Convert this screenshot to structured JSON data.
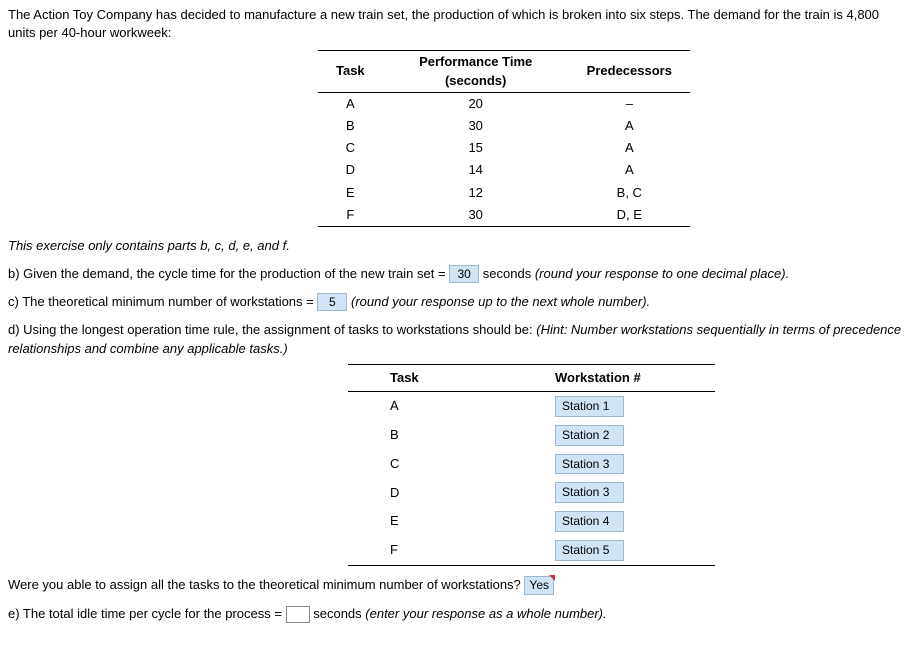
{
  "intro": "The Action Toy Company has decided to manufacture a new train set, the production of which is broken into six steps. The demand for the train is 4,800 units per 40-hour workweek:",
  "table1": {
    "headers": {
      "task": "Task",
      "perf": "Performance Time (seconds)",
      "pred": "Predecessors"
    },
    "rows": [
      {
        "task": "A",
        "time": "20",
        "pred": "–"
      },
      {
        "task": "B",
        "time": "30",
        "pred": "A"
      },
      {
        "task": "C",
        "time": "15",
        "pred": "A"
      },
      {
        "task": "D",
        "time": "14",
        "pred": "A"
      },
      {
        "task": "E",
        "time": "12",
        "pred": "B, C"
      },
      {
        "task": "F",
        "time": "30",
        "pred": "D, E"
      }
    ]
  },
  "parts_note": "This exercise only contains parts b, c, d, e, and f.",
  "b": {
    "pre": "b) Given the demand, the cycle time for the production of the new train set =",
    "ans": "30",
    "post1": "seconds",
    "post2": "(round your response to one decimal place)."
  },
  "c": {
    "pre": "c) The theoretical minimum number of workstations =",
    "ans": "5",
    "post": "(round your response up to the next whole number)."
  },
  "d": {
    "pre": "d) Using the longest operation time rule, the assignment of tasks to workstations should be:",
    "hint": "(Hint: Number workstations sequentially in terms of precedence relationships and combine any applicable tasks.)"
  },
  "table2": {
    "headers": {
      "task": "Task",
      "ws": "Workstation #"
    },
    "rows": [
      {
        "task": "A",
        "ws": "Station 1"
      },
      {
        "task": "B",
        "ws": "Station 2"
      },
      {
        "task": "C",
        "ws": "Station 3"
      },
      {
        "task": "D",
        "ws": "Station 3"
      },
      {
        "task": "E",
        "ws": "Station 4"
      },
      {
        "task": "F",
        "ws": "Station 5"
      }
    ]
  },
  "assign_q": {
    "pre": "Were you able to assign all the tasks to the theoretical minimum number of workstations?",
    "ans": "Yes"
  },
  "e": {
    "pre": "e) The total idle time per cycle for the process =",
    "post1": "seconds",
    "post2": "(enter your response as a whole number)."
  }
}
